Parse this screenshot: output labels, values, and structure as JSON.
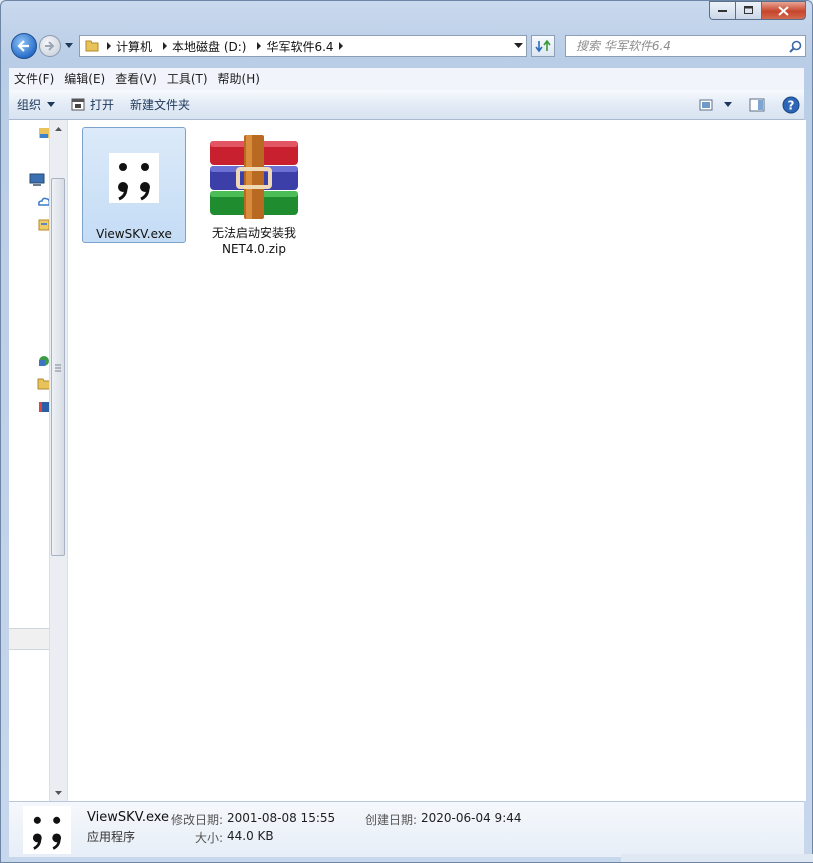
{
  "window": {
    "caption": {
      "minimize": "minimize-icon",
      "maximize": "maximize-icon",
      "close": "close-icon"
    }
  },
  "navigation": {
    "breadcrumbs": [
      "计算机",
      "本地磁盘 (D:)",
      "华军软件6.4"
    ],
    "search_placeholder": "搜索 华军软件6.4"
  },
  "menubar": {
    "items": [
      "文件(F)",
      "编辑(E)",
      "查看(V)",
      "工具(T)",
      "帮助(H)"
    ]
  },
  "commandbar": {
    "organize": "组织",
    "open": "打开",
    "new_folder": "新建文件夹"
  },
  "files": [
    {
      "name": "ViewSKV.exe",
      "icon": "viewskv-exe-icon",
      "selected": true
    },
    {
      "name_line1": "无法启动安装我",
      "name_line2": "NET4.0.zip",
      "icon": "winrar-archive-icon",
      "selected": false
    }
  ],
  "details": {
    "name": "ViewSKV.exe",
    "type": "应用程序",
    "modified_label": "修改日期:",
    "modified_value": "2001-08-08 15:55",
    "created_label": "创建日期:",
    "created_value": "2020-06-04 9:44",
    "size_label": "大小:",
    "size_value": "44.0 KB"
  },
  "colors": {
    "accent": "#2a6fc9",
    "selection": "#cde3f8",
    "command_text": "#1e395b"
  }
}
